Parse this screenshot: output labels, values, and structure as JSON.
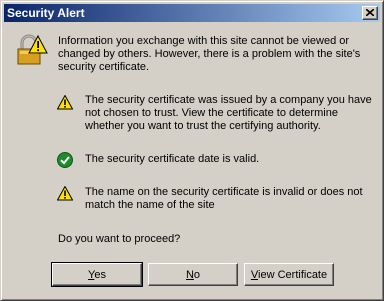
{
  "dialog": {
    "title": "Security Alert",
    "intro": "Information you exchange with this site cannot be viewed or changed by others. However, there is a problem with the site's security certificate.",
    "checks": [
      {
        "icon": "warning-icon",
        "text": "The security certificate was issued by a company you have not chosen to trust. View the certificate to determine whether you want to trust the certifying authority."
      },
      {
        "icon": "check-icon",
        "text": "The security certificate date is valid."
      },
      {
        "icon": "warning-icon",
        "text": "The name on the security certificate is invalid or does not match the name of the site"
      }
    ],
    "question": "Do you want to proceed?"
  },
  "buttons": {
    "yes": {
      "mnemonic": "Y",
      "rest": "es"
    },
    "no": {
      "mnemonic": "N",
      "rest": "o"
    },
    "view": {
      "mnemonic": "V",
      "rest": "iew Certificate"
    }
  },
  "colors": {
    "titlebar_start": "#0a246a",
    "titlebar_end": "#a6caf0",
    "face": "#d4d0c8",
    "warning": "#ffe100",
    "check": "#1f8b2c"
  }
}
